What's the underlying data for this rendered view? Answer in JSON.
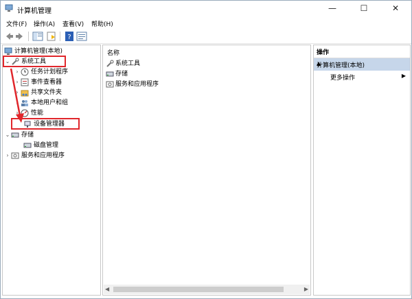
{
  "window": {
    "title": "计算机管理",
    "buttons": {
      "minimize": "—",
      "maximize": "☐",
      "close": "✕"
    }
  },
  "menu": [
    {
      "label": "文件(F)"
    },
    {
      "label": "操作(A)"
    },
    {
      "label": "查看(V)"
    },
    {
      "label": "帮助(H)"
    }
  ],
  "tree": {
    "root": "计算机管理(本地)",
    "system_tools": "系统工具",
    "task_scheduler": "任务计划程序",
    "event_viewer": "事件查看器",
    "shared_folders": "共享文件夹",
    "local_users": "本地用户和组",
    "performance": "性能",
    "device_manager": "设备管理器",
    "storage": "存储",
    "disk_management": "磁盘管理",
    "services_apps": "服务和应用程序"
  },
  "middle": {
    "column_header": "名称",
    "items": [
      "系统工具",
      "存储",
      "服务和应用程序"
    ]
  },
  "actions": {
    "header": "操作",
    "section": "计算机管理(本地)",
    "more": "更多操作"
  },
  "colors": {
    "highlight_red": "#e0262b",
    "section_bg": "#c6d6ea"
  }
}
